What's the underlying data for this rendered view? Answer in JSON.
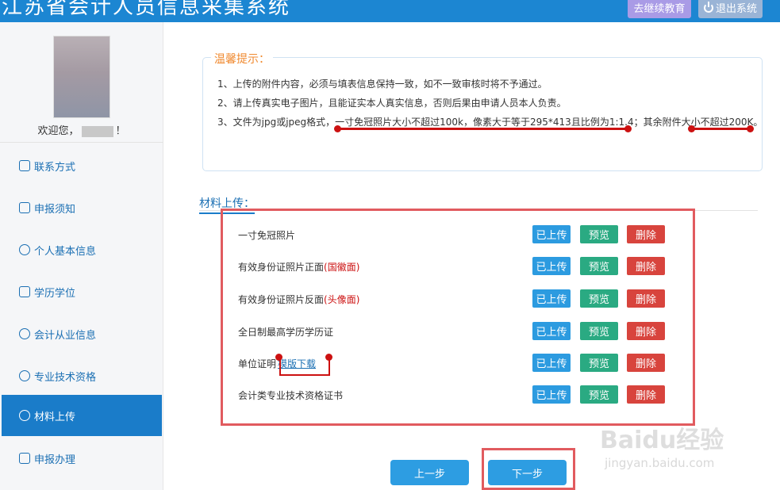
{
  "header": {
    "title": "江苏省会计人员信息采集系统",
    "continue_label": "去继续教育",
    "logout_label": "退出系统"
  },
  "profile": {
    "welcome_prefix": "欢迎您，",
    "welcome_suffix": "！"
  },
  "sidebar": {
    "items": [
      {
        "label": "联系方式",
        "icon": "address-card-icon"
      },
      {
        "label": "申报须知",
        "icon": "notice-icon"
      },
      {
        "label": "个人基本信息",
        "icon": "user-icon"
      },
      {
        "label": "学历学位",
        "icon": "graduation-cap-icon"
      },
      {
        "label": "会计从业信息",
        "icon": "users-icon"
      },
      {
        "label": "专业技术资格",
        "icon": "info-circle-icon"
      },
      {
        "label": "材料上传",
        "icon": "cloud-upload-icon",
        "active": true
      },
      {
        "label": "申报办理",
        "icon": "form-icon"
      }
    ]
  },
  "notice": {
    "title": "温馨提示：",
    "lines": [
      "1、上传的附件内容，必须与填表信息保持一致，如不一致审核时将不予通过。",
      "2、请上传真实电子图片，且能证实本人真实信息，否则后果由申请人员本人负责。",
      "3、文件为jpg或jpeg格式，一寸免冠照片大小不超过100k，像素大于等于295*413且比例为1:1.4；其余附件大小不超过200K。"
    ]
  },
  "upload": {
    "section_label": "材料上传：",
    "uploaded_label": "已上传",
    "preview_label": "预览",
    "delete_label": "删除",
    "rows": [
      {
        "name": "一寸免冠照片",
        "highlight": ""
      },
      {
        "name": "有效身份证照片正面",
        "highlight": "(国徽面)"
      },
      {
        "name": "有效身份证照片反面",
        "highlight": "(头像面)"
      },
      {
        "name": "全日制最高学历学历证",
        "highlight": ""
      },
      {
        "name": "单位证明",
        "highlight": "",
        "link": "模版下载"
      },
      {
        "name": "会计类专业技术资格证书",
        "highlight": ""
      }
    ]
  },
  "footer": {
    "prev_label": "上一步",
    "next_label": "下一步"
  },
  "watermark": {
    "main": "Baidu经验",
    "sub": "jingyan.baidu.com"
  },
  "colors": {
    "primary": "#1a7cc9",
    "uploaded": "#2c9be0",
    "preview": "#2aaa82",
    "delete": "#d8443d",
    "annotation": "#e15b5f"
  }
}
